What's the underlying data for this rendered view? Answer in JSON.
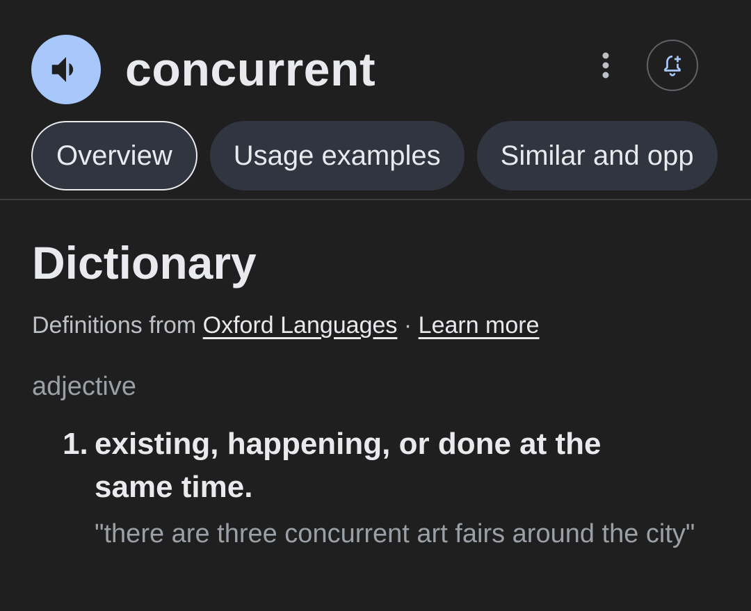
{
  "header": {
    "word": "concurrent",
    "speaker_icon": "volume-up-icon",
    "more_icon": "more-vert-icon",
    "alert_icon": "add-alert-icon"
  },
  "tabs": [
    {
      "label": "Overview",
      "active": true
    },
    {
      "label": "Usage examples",
      "active": false
    },
    {
      "label": "Similar and opp",
      "active": false
    }
  ],
  "dictionary": {
    "title": "Dictionary",
    "source_prefix": "Definitions from",
    "source_link": "Oxford Languages",
    "separator": "·",
    "learn_more": "Learn more",
    "part_of_speech": "adjective",
    "definitions": [
      {
        "number": "1.",
        "text": "existing, happening, or done at the same time.",
        "example": "\"there are three concurrent art fairs around the city\""
      }
    ]
  },
  "colors": {
    "background": "#1f1f1f",
    "speaker_button": "#a8c7fa",
    "tab_background": "#303540",
    "alert_icon": "#a8c7fa"
  }
}
